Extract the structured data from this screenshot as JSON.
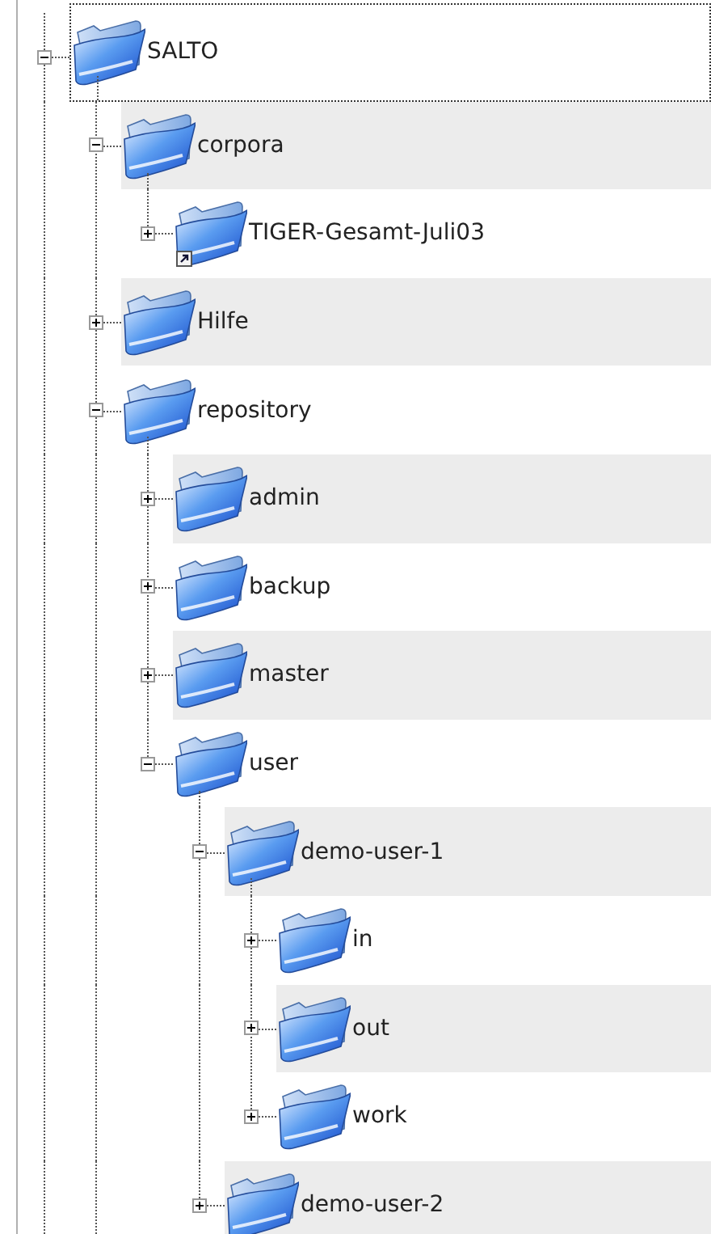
{
  "tree": [
    {
      "label": "SALTO",
      "expanded": true,
      "focused": true,
      "continues": true,
      "children": [
        {
          "label": "corpora",
          "expanded": true,
          "focused": false,
          "children": [
            {
              "label": "TIGER-Gesamt-Juli03",
              "expanded": false,
              "focused": false,
              "shortcut": true
            }
          ]
        },
        {
          "label": "Hilfe",
          "expanded": false,
          "focused": false
        },
        {
          "label": "repository",
          "expanded": true,
          "focused": false,
          "continues": true,
          "children": [
            {
              "label": "admin",
              "expanded": false,
              "focused": false
            },
            {
              "label": "backup",
              "expanded": false,
              "focused": false
            },
            {
              "label": "master",
              "expanded": false,
              "focused": false
            },
            {
              "label": "user",
              "expanded": true,
              "focused": false,
              "children": [
                {
                  "label": "demo-user-1",
                  "expanded": true,
                  "focused": false,
                  "children": [
                    {
                      "label": "in",
                      "expanded": false,
                      "focused": false
                    },
                    {
                      "label": "out",
                      "expanded": false,
                      "focused": false
                    },
                    {
                      "label": "work",
                      "expanded": false,
                      "focused": false
                    }
                  ]
                },
                {
                  "label": "demo-user-2",
                  "expanded": false,
                  "focused": false
                }
              ]
            }
          ]
        }
      ]
    }
  ]
}
